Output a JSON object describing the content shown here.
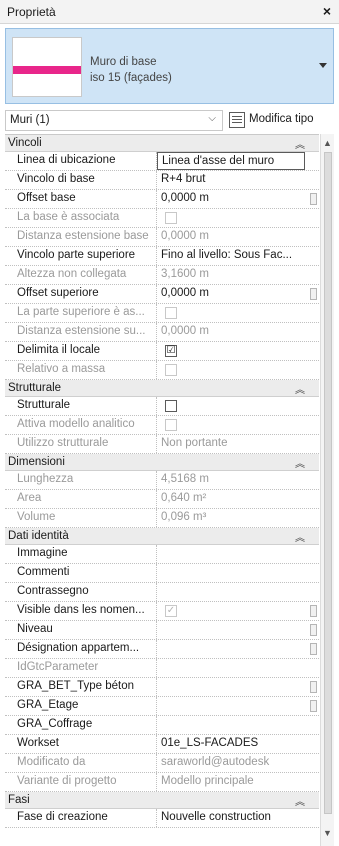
{
  "panel": {
    "title": "Proprietà",
    "close_glyph": "×"
  },
  "type_selector": {
    "name_line1": "Muro di base",
    "name_line2": "iso 15 (façades)"
  },
  "filter": {
    "label": "Muri (1)",
    "edit_type_label": "Modifica tipo"
  },
  "sections": {
    "vincoli": "Vincoli",
    "strutturale": "Strutturale",
    "dimensioni": "Dimensioni",
    "dati_identita": "Dati identità",
    "fasi": "Fasi"
  },
  "rows": [
    {
      "label": "Linea di ubicazione",
      "value": "Linea d'asse del muro"
    },
    {
      "label": "Vincolo di base",
      "value": "R+4 brut"
    },
    {
      "label": "Offset base",
      "value": "0,0000 m"
    },
    {
      "label": "La base è associata",
      "value": ""
    },
    {
      "label": "Distanza estensione base",
      "value": "0,0000 m"
    },
    {
      "label": "Vincolo parte superiore",
      "value": "Fino al livello: Sous Fac..."
    },
    {
      "label": "Altezza non collegata",
      "value": "3,1600 m"
    },
    {
      "label": "Offset superiore",
      "value": "0,0000 m"
    },
    {
      "label": "La parte superiore è as...",
      "value": ""
    },
    {
      "label": "Distanza estensione su...",
      "value": "0,0000 m"
    },
    {
      "label": "Delimita il locale",
      "value": "☑"
    },
    {
      "label": "Relativo a massa",
      "value": ""
    },
    {
      "label": "Strutturale",
      "value": ""
    },
    {
      "label": "Attiva modello analitico",
      "value": ""
    },
    {
      "label": "Utilizzo strutturale",
      "value": "Non portante"
    },
    {
      "label": "Lunghezza",
      "value": "4,5168 m"
    },
    {
      "label": "Area",
      "value": "0,640 m²"
    },
    {
      "label": "Volume",
      "value": "0,096 m³"
    },
    {
      "label": "Immagine",
      "value": ""
    },
    {
      "label": "Commenti",
      "value": ""
    },
    {
      "label": "Contrassegno",
      "value": ""
    },
    {
      "label": "Visible dans les nomen...",
      "value": "✓"
    },
    {
      "label": "Niveau",
      "value": ""
    },
    {
      "label": "Désignation appartem...",
      "value": ""
    },
    {
      "label": "IdGtcParameter",
      "value": ""
    },
    {
      "label": "GRA_BET_Type béton",
      "value": ""
    },
    {
      "label": "GRA_Etage",
      "value": ""
    },
    {
      "label": "GRA_Coffrage",
      "value": ""
    },
    {
      "label": "Workset",
      "value": "01e_LS-FACADES"
    },
    {
      "label": "Modificato da",
      "value": "saraworld@autodesk"
    },
    {
      "label": "Variante di progetto",
      "value": "Modello principale"
    },
    {
      "label": "Fase di creazione",
      "value": "Nouvelle construction"
    }
  ],
  "colors": {
    "type_selector_bg": "#cfe4f6",
    "swatch_stripe": "#e8268a",
    "section_bg": "#ececec"
  }
}
